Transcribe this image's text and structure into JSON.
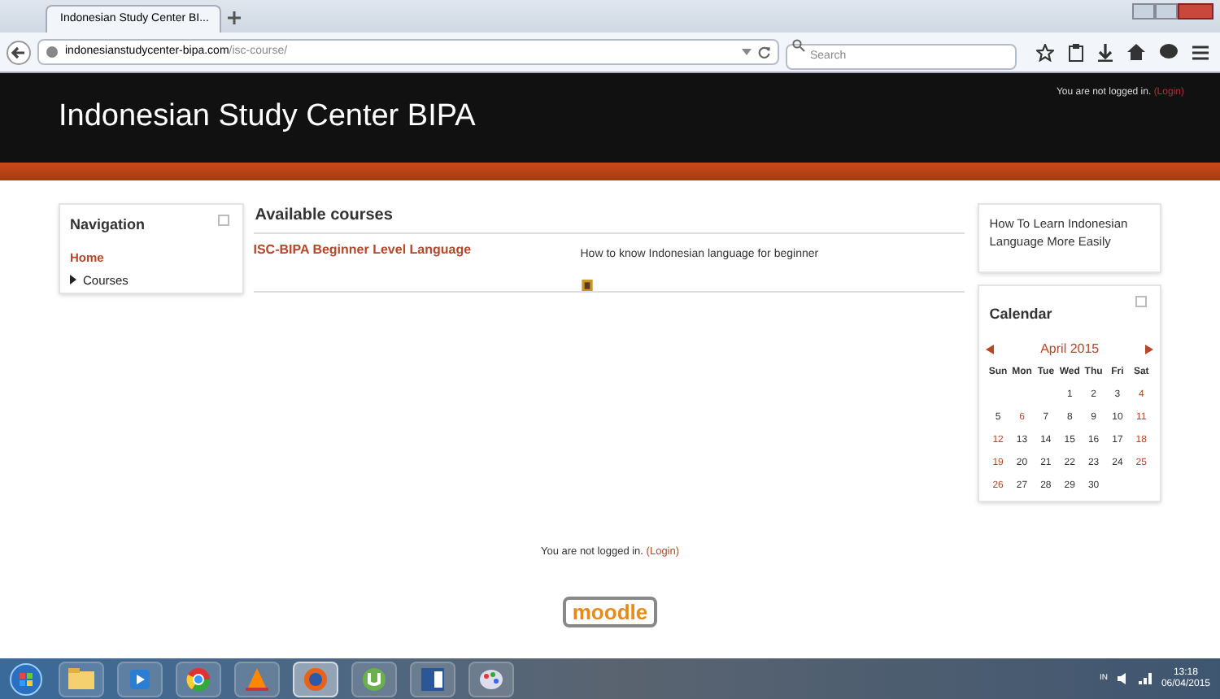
{
  "browser": {
    "tab": {
      "title": "Indonesian Study Center BI...",
      "selected": true
    },
    "url_host": "indonesianstudycenter-bipa.com",
    "url_path": "/isc-course/",
    "search": {
      "placeholder": "Search"
    }
  },
  "header": {
    "site_name": "Indonesian Study Center BIPA",
    "login_text": "You are not logged in.",
    "login_link": "(Login)"
  },
  "navigation": {
    "title": "Navigation",
    "items": [
      {
        "label": "Home",
        "kind": "link"
      },
      {
        "label": "Courses",
        "kind": "branch",
        "expanded": false
      }
    ]
  },
  "courses": {
    "title": "Available courses",
    "items": [
      {
        "name": "ISC-BIPA Beginner Level Language",
        "summary": "How to know Indonesian language for beginner"
      }
    ]
  },
  "side_text": "How To Learn Indonesian Language More Easily",
  "calendar": {
    "title": "Calendar",
    "month": "April 2015",
    "weekdays": [
      "Sun",
      "Mon",
      "Tue",
      "Wed",
      "Thu",
      "Fri",
      "Sat"
    ],
    "weeks": [
      [
        {
          "day": "1",
          "highlighted": false
        },
        {
          "day": "2",
          "highlighted": false
        },
        {
          "day": "3",
          "highlighted": false
        },
        {
          "day": "4",
          "highlighted": true
        }
      ],
      [
        {
          "day": "5",
          "highlighted": false
        },
        {
          "day": "6",
          "highlighted": true
        },
        {
          "day": "7",
          "highlighted": false
        },
        {
          "day": "8",
          "highlighted": false
        },
        {
          "day": "9",
          "highlighted": false
        },
        {
          "day": "10",
          "highlighted": false
        },
        {
          "day": "11",
          "highlighted": true
        }
      ],
      [
        {
          "day": "12",
          "highlighted": true
        },
        {
          "day": "13",
          "highlighted": false
        },
        {
          "day": "14",
          "highlighted": false
        },
        {
          "day": "15",
          "highlighted": false
        },
        {
          "day": "16",
          "highlighted": false
        },
        {
          "day": "17",
          "highlighted": false
        },
        {
          "day": "18",
          "highlighted": true
        }
      ],
      [
        {
          "day": "19",
          "highlighted": true
        },
        {
          "day": "20",
          "highlighted": false
        },
        {
          "day": "21",
          "highlighted": false
        },
        {
          "day": "22",
          "highlighted": false
        },
        {
          "day": "23",
          "highlighted": false
        },
        {
          "day": "24",
          "highlighted": false
        },
        {
          "day": "25",
          "highlighted": true
        }
      ],
      [
        {
          "day": "26",
          "highlighted": true
        },
        {
          "day": "27",
          "highlighted": false
        },
        {
          "day": "28",
          "highlighted": false
        },
        {
          "day": "29",
          "highlighted": false
        },
        {
          "day": "30",
          "highlighted": false
        }
      ]
    ]
  },
  "footer": {
    "login_text": "You are not logged in.",
    "login_link": "(Login)",
    "logo": "moodle"
  },
  "taskbar": {
    "apps": [
      {
        "kind": "folder"
      },
      {
        "kind": "media"
      },
      {
        "kind": "chrome"
      },
      {
        "kind": "vlc"
      },
      {
        "kind": "firefox",
        "selected": true
      },
      {
        "kind": "torrent"
      },
      {
        "kind": "word"
      },
      {
        "kind": "paint"
      }
    ],
    "language": "IN",
    "time": "13:18",
    "date": "06/04/2015"
  }
}
